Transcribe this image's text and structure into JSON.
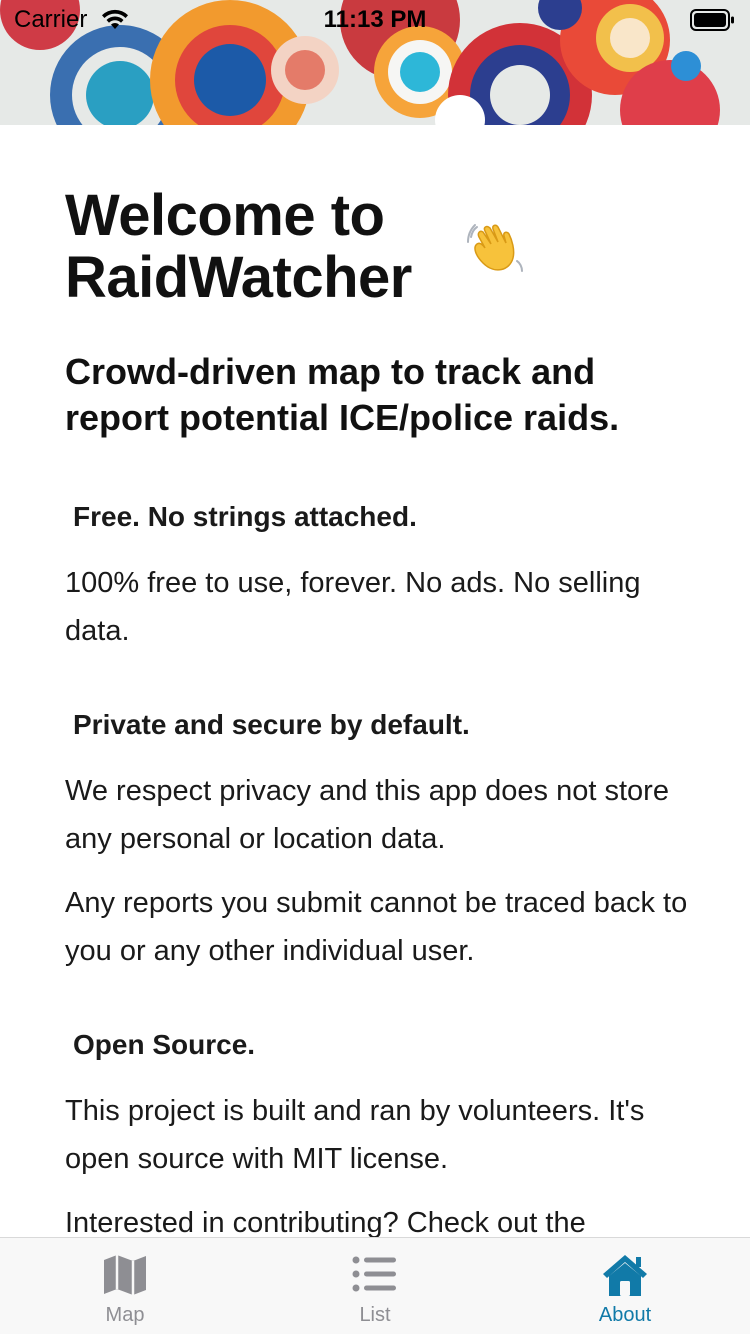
{
  "status_bar": {
    "carrier": "Carrier",
    "time": "11:13 PM"
  },
  "header": {
    "title": "Welcome to RaidWatcher",
    "title_line1": "Welcome to",
    "title_line2": "RaidWatcher",
    "title_emoji": "waving-hand-icon",
    "subtitle": "Crowd-driven map to track and report potential ICE/police raids."
  },
  "sections": [
    {
      "heading": "Free. No strings attached.",
      "paragraphs": [
        "100% free to use, forever. No ads. No selling data."
      ]
    },
    {
      "heading": "Private and secure by default.",
      "paragraphs": [
        "We respect privacy and this app does not store any personal or location data.",
        "Any reports you submit cannot be traced back to you or any other individual user."
      ]
    },
    {
      "heading": "Open Source.",
      "paragraphs": [
        "This project is built and ran by volunteers. It's open source with MIT license.",
        "Interested in contributing? Check out the"
      ]
    }
  ],
  "tab_bar": {
    "tabs": [
      {
        "label": "Map",
        "icon": "map-icon",
        "active": false
      },
      {
        "label": "List",
        "icon": "list-icon",
        "active": false
      },
      {
        "label": "About",
        "icon": "house-icon",
        "active": true
      }
    ]
  },
  "colors": {
    "accent": "#117aa8",
    "inactive_tab": "#8e8e93",
    "text": "#1a1a1a",
    "tab_bar_bg": "#f8f8f8"
  }
}
